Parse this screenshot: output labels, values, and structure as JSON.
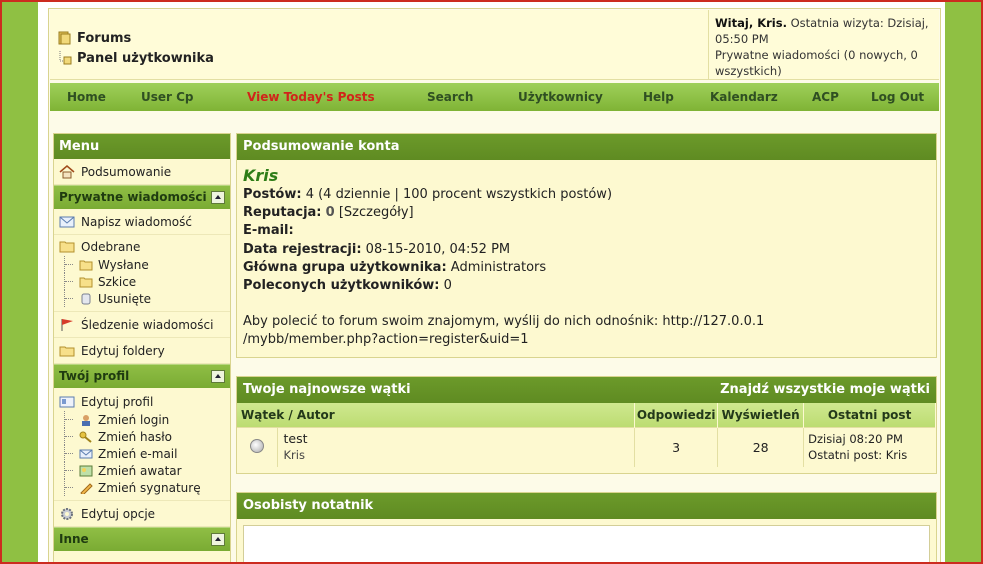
{
  "breadcrumb": {
    "root": "Forums",
    "current": "Panel użytkownika"
  },
  "welcome": {
    "greeting": "Witaj, Kris.",
    "last_visit": "Ostatnia wizyta: Dzisiaj, 05:50 PM",
    "pm": "Prywatne wiadomości (0 nowych, 0 wszystkich)"
  },
  "nav": [
    "Home",
    "User Cp",
    "View Today's Posts",
    "Search",
    "Użytkownicy",
    "Help",
    "Kalendarz",
    "ACP",
    "Log Out"
  ],
  "sidebar": {
    "title": "Menu",
    "summary": "Podsumowanie",
    "pm_section": "Prywatne wiadomości",
    "compose": "Napisz wiadomość",
    "inbox": "Odebrane",
    "sent": "Wysłane",
    "drafts": "Szkice",
    "trash": "Usunięte",
    "tracking": "Śledzenie wiadomości",
    "folders": "Edytuj foldery",
    "profile_section": "Twój profil",
    "edit_profile": "Edytuj profil",
    "change_login": "Zmień login",
    "change_password": "Zmień hasło",
    "change_email": "Zmień e-mail",
    "change_avatar": "Zmień awatar",
    "change_signature": "Zmień sygnaturę",
    "edit_options": "Edytuj opcje",
    "other_section": "Inne"
  },
  "account": {
    "title": "Podsumowanie konta",
    "username": "Kris",
    "posts_label": "Postów:",
    "posts_value": "4 (4 dziennie | 100 procent wszystkich postów)",
    "rep_label": "Reputacja:",
    "rep_value": "0",
    "rep_link": "[Szczegóły]",
    "email_label": "E-mail:",
    "reg_label": "Data rejestracji:",
    "reg_value": "08-15-2010, 04:52 PM",
    "group_label": "Główna grupa użytkownika:",
    "group_value": "Administrators",
    "ref_label": "Poleconych użytkowników:",
    "ref_value": "0",
    "invite_text": "Aby polecić to forum swoim znajomym, wyślij do nich odnośnik: http://127.0.0.1",
    "invite_text2": "/mybb/member.php?action=register&uid=1"
  },
  "threads": {
    "title": "Twoje najnowsze wątki",
    "find_all": "Znajdź wszystkie moje wątki",
    "headers": [
      "Wątek / Autor",
      "Odpowiedzi",
      "Wyświetleń",
      "Ostatni post"
    ],
    "rows": [
      {
        "title": "test",
        "author": "Kris",
        "replies": "3",
        "views": "28",
        "last_date": "Dzisiaj 08:20 PM",
        "last_by": "Ostatni post: Kris"
      }
    ]
  },
  "notepad": {
    "title": "Osobisty notatnik"
  }
}
